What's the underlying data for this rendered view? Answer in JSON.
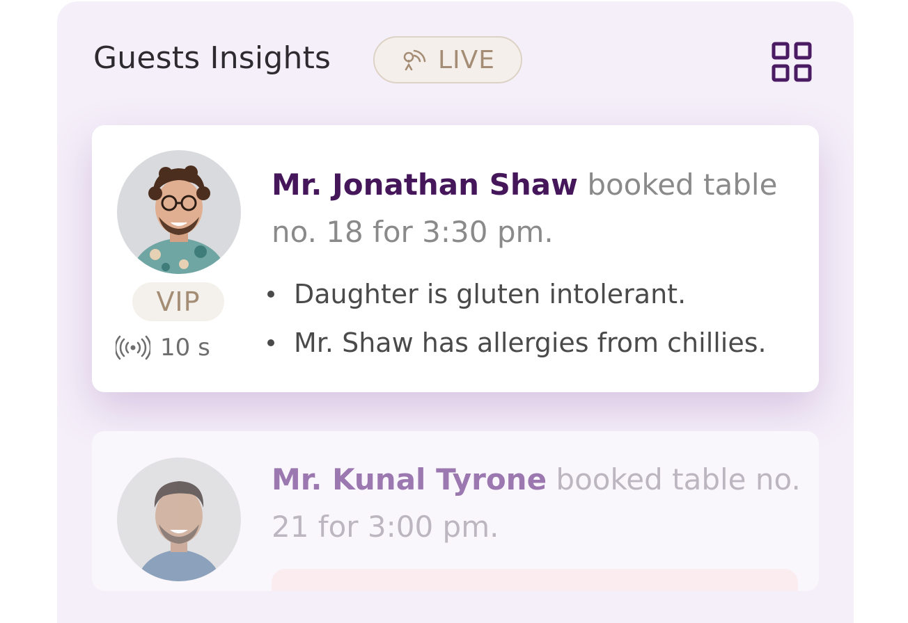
{
  "header": {
    "title": "Guests Insights",
    "live_label": "LIVE",
    "grid_icon": "grid-view-icon"
  },
  "colors": {
    "panel_bg": "#f5eff9",
    "guest_name": "#45165a",
    "badge_text": "#a48d74",
    "grid_icon": "#4a1a63"
  },
  "insights": [
    {
      "guest_name": "Mr. Jonathan Shaw",
      "message": "booked table no. 18 for 3:30 pm.",
      "badge": "VIP",
      "time_ago": "10 s",
      "notes": [
        "Daughter is gluten intolerant.",
        "Mr. Shaw has allergies from chillies."
      ]
    },
    {
      "guest_name": "Mr. Kunal Tyrone",
      "message": "booked table no. 21 for 3:00 pm."
    }
  ]
}
